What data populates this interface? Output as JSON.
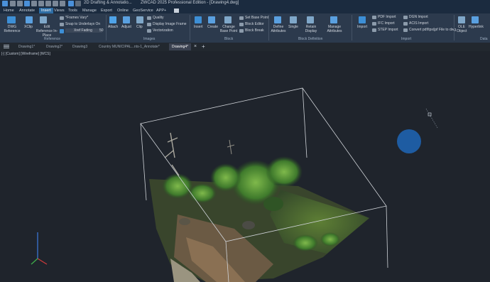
{
  "titlebar": {
    "workspace": "2D Drafting & Annotatio...",
    "app_title": "ZWCAD 2025 Professional Edition - [Drawing4.dwg]"
  },
  "menu": [
    "Home",
    "Annotate",
    "Insert",
    "Views",
    "Tools",
    "Manage",
    "Export",
    "Online",
    "GeoService",
    "APP+"
  ],
  "menu_active_index": 2,
  "ribbon": {
    "reference": {
      "dwg_reference": "DWG Reference",
      "xclip": "XClip",
      "edit_reference": "Edit Reference In-Place",
      "frames_vary": "*Frames Vary*",
      "snap_underlays": "Snap to Underlays On",
      "xref_fading": "Xref Fading",
      "xref_fading_value": "50",
      "group_label": "Reference"
    },
    "images": {
      "attach": "Attach",
      "adjust": "Adjust",
      "clip": "Clip",
      "quality": "Quality",
      "display_image_frame": "Display Image Frame",
      "vectorization": "Vectorization",
      "group_label": "Images"
    },
    "block": {
      "insert": "Insert",
      "create": "Create",
      "change_base_point": "Change Base Point",
      "set_base_point": "Set Base Point",
      "block_editor": "Block Editor",
      "block_break": "Block Break",
      "group_label": "Block"
    },
    "block_definition": {
      "define_attributes": "Define Attributes",
      "single": "Single",
      "retain_display": "Retain Display",
      "manage_attributes": "Manage Attributes",
      "group_label": "Block Definition"
    },
    "import": {
      "import": "Import",
      "pdf_import": "PDF Import",
      "ifc_import": "IFC Import",
      "step_import": "STEP Import",
      "dgn_import": "DGN Import",
      "acis_import": "ACIS Import",
      "convert_pdf": "Convert pdf/tpx/jpf File to dwg",
      "group_label": "Import"
    },
    "data": {
      "ole_object": "OLE Object",
      "hyperlink": "Hyperlink",
      "group_label": "Data"
    }
  },
  "doc_tabs": [
    "Drawing1*",
    "Drawing2*",
    "Drawing3",
    "Country MUNICIPAL...nts-1_Annotate*",
    "Drawing4*"
  ],
  "doc_tab_active_index": 4,
  "viewport": {
    "label": "[-] [Custom] [Wireframe] [WCS]"
  },
  "colors": {
    "accent": "#2e6da4",
    "background": "#1f242c",
    "ribbon": "#2c3a4d"
  }
}
